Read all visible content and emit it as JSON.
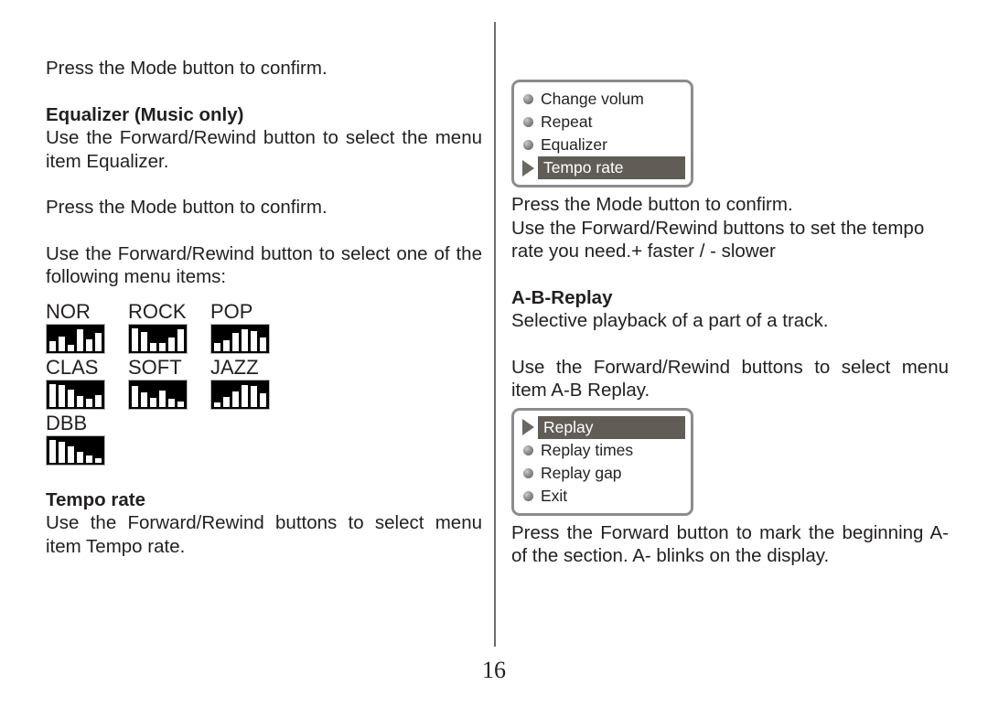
{
  "page": {
    "number": "16"
  },
  "left_column": {
    "intro_para": "Press the Mode button to confirm.",
    "equalizer_heading": "Equalizer (Music only)",
    "equalizer_para_1": "Use the Forward/Rewind button to select the menu item Equalizer.",
    "equalizer_para_2": "Press the Mode button to confirm.",
    "equalizer_para_3": "Use the Forward/Rewind button to select one of the following menu items:",
    "equalizer_presets": [
      {
        "label": "NOR",
        "bars": [
          38,
          58,
          24,
          88,
          46,
          74
        ]
      },
      {
        "label": "ROCK",
        "bars": [
          90,
          76,
          30,
          32,
          54,
          86
        ]
      },
      {
        "label": "POP",
        "bars": [
          30,
          44,
          72,
          88,
          78,
          52
        ]
      },
      {
        "label": "CLAS",
        "bars": [
          92,
          86,
          70,
          42,
          30,
          48
        ]
      },
      {
        "label": "SOFT",
        "bars": [
          84,
          58,
          36,
          66,
          30,
          22
        ]
      },
      {
        "label": "JAZZ",
        "bars": [
          18,
          40,
          62,
          88,
          84,
          52
        ]
      },
      {
        "label": "DBB",
        "bars": [
          92,
          82,
          64,
          44,
          28,
          18
        ]
      }
    ],
    "tempo_heading": "Tempo rate",
    "tempo_para": "Use the Forward/Rewind buttons to select menu item Tempo rate."
  },
  "right_column": {
    "menu_tempo": {
      "items": [
        {
          "label": "Change volum",
          "marker": "bullet-icon",
          "selected": false
        },
        {
          "label": "Repeat",
          "marker": "bullet-icon",
          "selected": false
        },
        {
          "label": "Equalizer",
          "marker": "bullet-icon",
          "selected": false
        },
        {
          "label": "Tempo rate",
          "marker": "arrow-icon",
          "selected": true
        }
      ]
    },
    "tempo_para_1": "Press the Mode button to confirm.",
    "tempo_para_2": "Use the Forward/Rewind buttons to set the tempo rate you need.+ faster / - slower",
    "ab_heading": "A-B-Replay",
    "ab_para_1": "Selective playback of a part of a track.",
    "ab_para_2": "Use the Forward/Rewind buttons to select menu item A-B Replay.",
    "menu_replay": {
      "items": [
        {
          "label": "Replay",
          "marker": "arrow-icon",
          "selected": true
        },
        {
          "label": "Replay times",
          "marker": "bullet-icon",
          "selected": false
        },
        {
          "label": "Replay gap",
          "marker": "bullet-icon",
          "selected": false
        },
        {
          "label": "Exit",
          "marker": "bullet-icon",
          "selected": false
        }
      ]
    },
    "ab_para_3": "Press the Forward button to mark the beginning A- of the section.  A- blinks on the display."
  },
  "colors": {
    "text": "#231f20",
    "menu_border": "#8c8c8c",
    "menu_highlight": "#625c57",
    "divider": "#6d6d6d",
    "eq_icon_bg": "#000000",
    "eq_icon_bar": "#ffffff"
  }
}
